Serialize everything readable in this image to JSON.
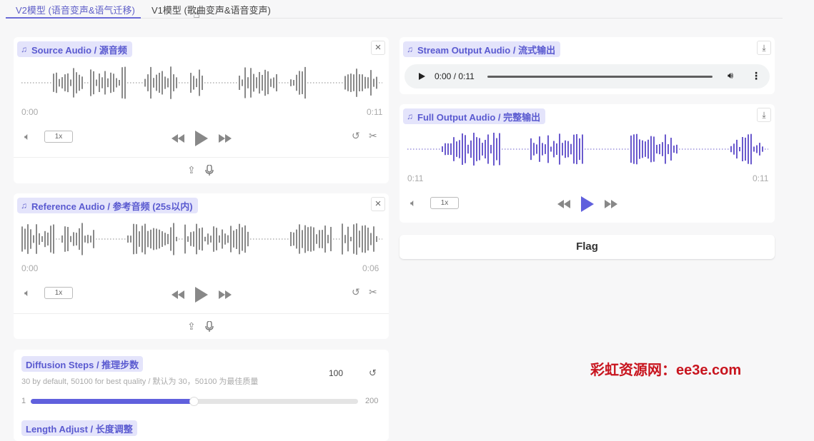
{
  "tabs": [
    {
      "label": "V2模型 (语音变声&语气迁移)"
    },
    {
      "label": "V1模型 (歌曲变声&语音变声)"
    }
  ],
  "source_audio": {
    "label": "Source Audio / 源音频",
    "time_start": "0:00",
    "time_end": "0:11",
    "speed": "1x"
  },
  "reference_audio": {
    "label": "Reference Audio / 参考音频 (25s以内)",
    "time_start": "0:00",
    "time_end": "0:06",
    "speed": "1x"
  },
  "stream_output": {
    "label": "Stream Output Audio / 流式输出",
    "time": "0:00 / 0:11"
  },
  "full_output": {
    "label": "Full Output Audio / 完整输出",
    "time_start": "0:11",
    "time_end": "0:11",
    "speed": "1x"
  },
  "flag_label": "Flag",
  "diffusion": {
    "label": "Diffusion Steps / 推理步数",
    "info": "30 by default, 50100 for best quality / 默认为 30，50100 为最佳质量",
    "value": "100",
    "reset": "↺",
    "min": "1",
    "max": "200",
    "fraction": 0.4975
  },
  "length_adjust": {
    "label": "Length Adjust / 长度调整"
  },
  "watermark": "彩虹资源网：ee3e.com",
  "colors": {
    "accent": "#6060dd",
    "label_bg": "#e4e4fb",
    "wave_grey": "#8a8a8a",
    "wave_purple": "#6a5acd"
  }
}
